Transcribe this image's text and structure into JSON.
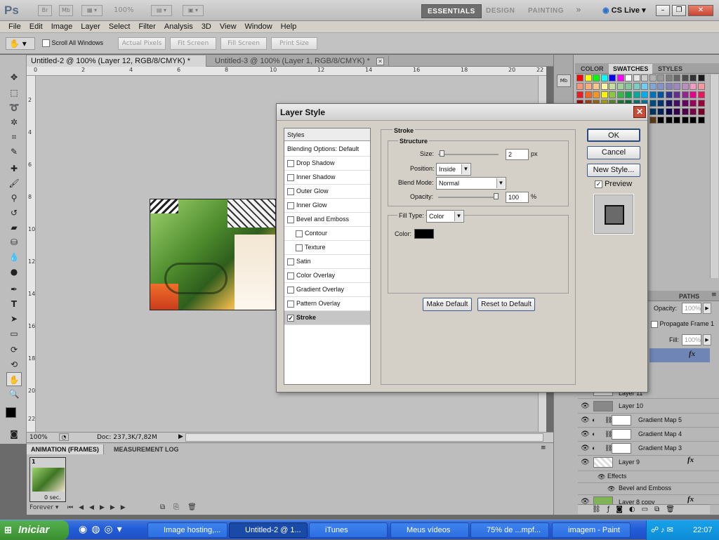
{
  "chart_data": {},
  "appbar": {
    "logo": "Ps",
    "zoom": "100%",
    "workspaces": [
      "ESSENTIALS",
      "DESIGN",
      "PAINTING"
    ],
    "more": "»",
    "cslive": "CS Live"
  },
  "menu": [
    "File",
    "Edit",
    "Image",
    "Layer",
    "Select",
    "Filter",
    "Analysis",
    "3D",
    "View",
    "Window",
    "Help"
  ],
  "options": {
    "scroll_all": "Scroll All Windows",
    "buttons": [
      "Actual Pixels",
      "Fit Screen",
      "Fill Screen",
      "Print Size"
    ]
  },
  "doc_tabs": [
    {
      "label": "Untitled-2 @ 100% (Layer 12, RGB/8/CMYK) *"
    },
    {
      "label": "Untitled-3 @ 100% (Layer 1, RGB/8/CMYK) *"
    }
  ],
  "ruler_h": [
    "0",
    "2",
    "4",
    "6",
    "8",
    "10",
    "12",
    "14",
    "16",
    "18",
    "20",
    "22"
  ],
  "ruler_v": [
    "2",
    "4",
    "6",
    "8",
    "10",
    "12",
    "14",
    "16",
    "18",
    "20",
    "22"
  ],
  "status": {
    "zoom": "100%",
    "doc": "Doc: 237,3K/7,82M"
  },
  "anim_panel": {
    "tabs": [
      "ANIMATION (FRAMES)",
      "MEASUREMENT LOG"
    ],
    "frame_number": "1",
    "frame_delay": "0 sec.",
    "loop": "Forever"
  },
  "color_panel": {
    "tabs": [
      "COLOR",
      "SWATCHES",
      "STYLES"
    ]
  },
  "layers_panel": {
    "tab": "PATHS",
    "opacity_label": "Opacity:",
    "opacity": "100%",
    "propagate": "Propagate Frame 1",
    "fill_label": "Fill:",
    "fill": "100%",
    "layers": [
      "Layer 11",
      "Layer 10",
      "Gradient Map 5",
      "Gradient Map 4",
      "Gradient Map 3",
      "Layer 9",
      "Effects",
      "Bevel and Emboss",
      "Layer 8 copy"
    ]
  },
  "dialog": {
    "title": "Layer Style",
    "styles_header": "Styles",
    "blending": "Blending Options: Default",
    "items": [
      "Drop Shadow",
      "Inner Shadow",
      "Outer Glow",
      "Inner Glow",
      "Bevel and Emboss",
      "Contour",
      "Texture",
      "Satin",
      "Color Overlay",
      "Gradient Overlay",
      "Pattern Overlay",
      "Stroke"
    ],
    "section": "Stroke",
    "structure": "Structure",
    "size_label": "Size:",
    "size": "2",
    "size_unit": "px",
    "size_level": 0.03,
    "position_label": "Position:",
    "position": "Inside",
    "blend_label": "Blend Mode:",
    "blend": "Normal",
    "opacity_label": "Opacity:",
    "opacity": "100",
    "opacity_unit": "%",
    "opacity_level": 1.0,
    "filltype_label": "Fill Type:",
    "filltype": "Color",
    "color_label": "Color:",
    "stroke_color": "#000000",
    "ok": "OK",
    "cancel": "Cancel",
    "new_style": "New Style...",
    "preview": "Preview",
    "make_default": "Make Default",
    "reset_default": "Reset to Default"
  },
  "taskbar": {
    "start": "Iniciar",
    "tasks": [
      "Image hosting,...",
      "Untitled-2 @ 1...",
      "iTunes",
      "Meus vídeos",
      "75% de ...mpf...",
      "imagem - Paint"
    ],
    "clock": "22:07"
  }
}
